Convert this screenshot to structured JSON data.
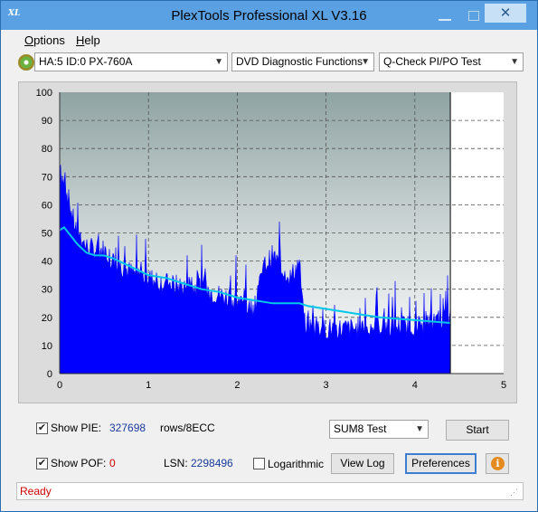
{
  "window": {
    "title": "PlexTools Professional XL V3.16",
    "icon_text": "XL"
  },
  "menu": {
    "options": "Options",
    "options_hotkey": "O",
    "options_rest": "ptions",
    "help": "Help",
    "help_hotkey": "H",
    "help_rest": "elp"
  },
  "toolbar": {
    "drive": "HA:5 ID:0  PX-760A",
    "function": "DVD Diagnostic Functions",
    "test": "Q-Check PI/PO Test"
  },
  "chart_data": {
    "type": "area",
    "x_ticks": [
      "0",
      "1",
      "2",
      "3",
      "4",
      "5"
    ],
    "y_ticks": [
      "0",
      "10",
      "20",
      "30",
      "40",
      "50",
      "60",
      "70",
      "80",
      "90",
      "100"
    ],
    "xlim": [
      0,
      5
    ],
    "ylim": [
      0,
      100
    ],
    "grid": true,
    "end_marker_x": 4.4,
    "series": [
      {
        "color": "#0000ff",
        "x": [
          0.0,
          0.05,
          0.1,
          0.15,
          0.2,
          0.3,
          0.4,
          0.5,
          0.6,
          0.7,
          0.8,
          1.0,
          1.2,
          1.4,
          1.6,
          1.8,
          2.0,
          2.1,
          2.15,
          2.2,
          2.3,
          2.4,
          2.5,
          2.6,
          2.7,
          2.75,
          2.8,
          3.0,
          3.2,
          3.4,
          3.6,
          3.8,
          4.0,
          4.2,
          4.4
        ],
        "values": [
          72,
          68,
          62,
          55,
          50,
          45,
          44,
          44,
          40,
          38,
          36,
          34,
          32,
          31,
          30,
          28,
          26,
          24,
          23,
          24,
          38,
          42,
          38,
          34,
          40,
          18,
          17,
          16,
          16,
          16,
          17,
          17,
          17,
          18,
          20
        ]
      },
      {
        "color": "#00c8e8",
        "x": [
          0.0,
          0.05,
          0.1,
          0.2,
          0.3,
          0.4,
          0.5,
          0.6,
          0.8,
          1.0,
          1.2,
          1.4,
          1.6,
          1.8,
          2.0,
          2.2,
          2.4,
          2.6,
          2.7,
          2.8,
          3.0,
          3.2,
          3.4,
          3.6,
          3.8,
          4.0,
          4.2,
          4.4
        ],
        "values": [
          51,
          52,
          50,
          46,
          43,
          42,
          42,
          41,
          38,
          35,
          34,
          32,
          30,
          29,
          27,
          26,
          25,
          25,
          25,
          24,
          23,
          22,
          21,
          20,
          19.5,
          19,
          18.5,
          18
        ]
      }
    ]
  },
  "controls": {
    "show_pie_label": "Show PIE:",
    "pie_value": "327698",
    "pie_unit": "rows/8ECC",
    "show_pof_label": "Show POF:",
    "pof_value": "0",
    "lsn_label": "LSN:",
    "lsn_value": "2298496",
    "logarithmic_label": "Logarithmic",
    "sum_select": "SUM8 Test",
    "start_button": "Start",
    "view_log_button": "View Log",
    "preferences_button": "Preferences",
    "show_pie_checked": true,
    "show_pof_checked": true,
    "logarithmic_checked": false
  },
  "status": {
    "text": "Ready"
  },
  "colors": {
    "titlebar": "#5aa1e3",
    "pie": "#0000ff",
    "pof_line": "#00c8e8",
    "status_text": "#cc0000"
  }
}
